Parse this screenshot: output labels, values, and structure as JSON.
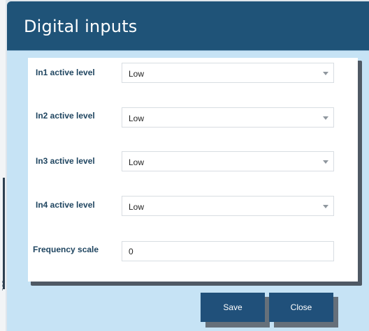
{
  "dialog": {
    "title": "Digital inputs"
  },
  "form": {
    "rows": [
      {
        "label": "In1 active level",
        "value": "Low",
        "icon": "chevron-down-icon"
      },
      {
        "label": "In2 active level",
        "value": "Low",
        "icon": "chevron-down-icon"
      },
      {
        "label": "In3 active level",
        "value": "Low",
        "icon": "chevron-down-icon"
      },
      {
        "label": "In4 active level",
        "value": "Low",
        "icon": "chevron-down-icon"
      }
    ],
    "frequency_scale": {
      "label": "Frequency scale",
      "value": "0"
    }
  },
  "buttons": {
    "save": "Save",
    "close": "Close"
  },
  "colors": {
    "titlebar": "#1f5378",
    "dialog_background": "#c6e3f5",
    "button": "#20507a",
    "label_text": "#1f4560"
  }
}
